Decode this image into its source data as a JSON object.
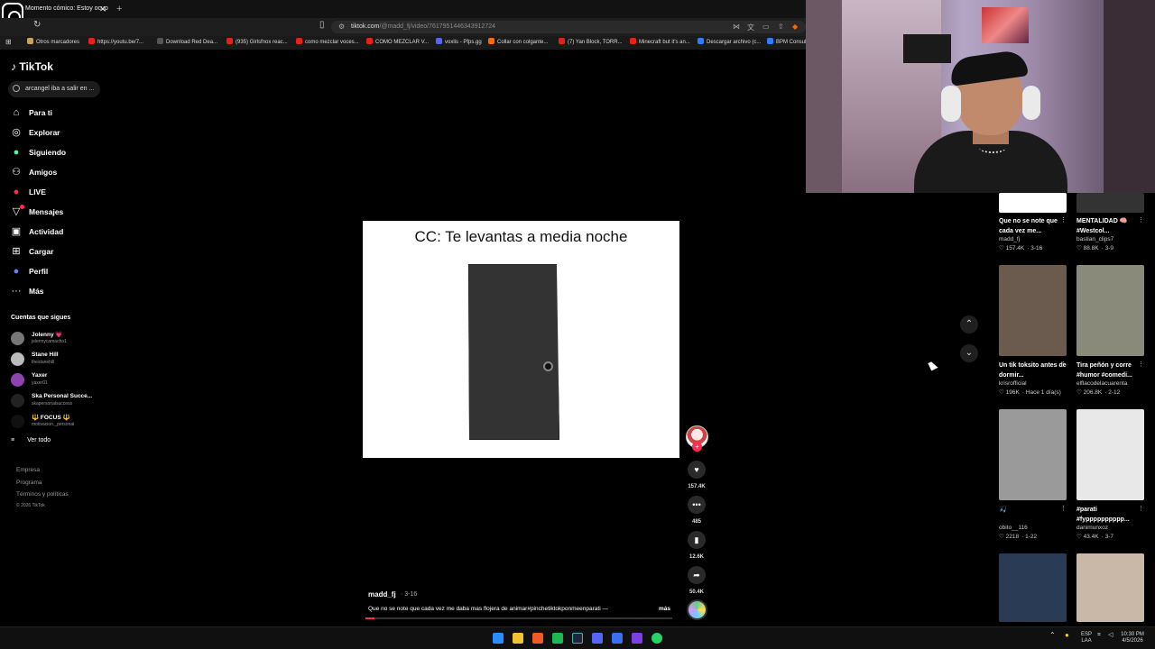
{
  "browser": {
    "tab_title": "Momento cómico: Estoy ocup",
    "tab_close": "✕",
    "new_tab": "+",
    "url_domain": "tiktok.com",
    "url_path": "/@madd_fj/video/7617951446343912724",
    "bookmarks": [
      {
        "label": "Otros marcadores",
        "color": "#c8a45a"
      },
      {
        "label": "https://youtu.be/7...",
        "color": "#e62117"
      },
      {
        "label": "Download Red Dea...",
        "color": "#555"
      },
      {
        "label": "(935) Girlsfnox reac...",
        "color": "#e62117"
      },
      {
        "label": "como mezclar voces...",
        "color": "#e62117"
      },
      {
        "label": "COMO MEZCLAR V...",
        "color": "#e62117"
      },
      {
        "label": "voxlis - Pfps.gg",
        "color": "#5865f2"
      },
      {
        "label": "Collar con colgante...",
        "color": "#ff6a00"
      },
      {
        "label": "(7) Yan Block, TORR...",
        "color": "#e62117"
      },
      {
        "label": "Minecraft but it's an...",
        "color": "#e62117"
      },
      {
        "label": "Descargar archivo (c...",
        "color": "#2d7ff9"
      },
      {
        "label": "BPM Consult",
        "color": "#2d7ff9"
      }
    ]
  },
  "tiktok": {
    "logo": "TikTok",
    "search_value": "arcangel iba a salir en ...",
    "menu": [
      {
        "label": "Para ti",
        "icon": "home-icon",
        "glyph": "⌂"
      },
      {
        "label": "Explorar",
        "icon": "compass-icon",
        "glyph": "◎"
      },
      {
        "label": "Siguiendo",
        "icon": "following-icon",
        "glyph": "●"
      },
      {
        "label": "Amigos",
        "icon": "friends-icon",
        "glyph": "⚇"
      },
      {
        "label": "LIVE",
        "icon": "live-icon",
        "glyph": "●"
      },
      {
        "label": "Mensajes",
        "icon": "messages-icon",
        "glyph": "▽"
      },
      {
        "label": "Actividad",
        "icon": "activity-icon",
        "glyph": "▣"
      },
      {
        "label": "Cargar",
        "icon": "upload-icon",
        "glyph": "⊞"
      },
      {
        "label": "Perfil",
        "icon": "profile-icon",
        "glyph": "●"
      },
      {
        "label": "Más",
        "icon": "more-icon",
        "glyph": "···"
      }
    ],
    "following_header": "Cuentas que sigues",
    "accounts": [
      {
        "name": "Jolenny 💗",
        "handle": "jelennycamacho1",
        "color": "#777"
      },
      {
        "name": "Stane Hill",
        "handle": "thestanehill",
        "color": "#bbb"
      },
      {
        "name": "Yaxer",
        "handle": "yaxer01",
        "color": "#8e44ad"
      },
      {
        "name": "Ska Personal Succe...",
        "handle": "skapersonalsuccess",
        "color": "#222"
      },
      {
        "name": "🔱 FOCUS 🔱",
        "handle": "motivacion._personal",
        "color": "#111"
      }
    ],
    "see_all": "Ver todo",
    "footer": [
      "Empresa",
      "Programa",
      "Términos y políticas",
      "© 2026 TikTok"
    ]
  },
  "video": {
    "overlay_text": "CC: Te levantas a media noche",
    "author": "madd_fj",
    "date": "· 3-16",
    "caption": "Que no se note que cada vez me daba mas flojera de animar#pinchetiktokponmeenparati —",
    "more": "más",
    "progress": 0.03,
    "likes": "157.4K",
    "comments": "485",
    "saves": "12.6K",
    "shares": "50.4K"
  },
  "suggested": [
    {
      "title": "Que no se note que cada vez me...",
      "user": "madd_fj",
      "likes": "♡ 157.4K",
      "date": "· 3-16",
      "thumb": "#ffffff"
    },
    {
      "title": "MENTALIDAD 🧠 #Westcol...",
      "user": "bastian_clips7",
      "likes": "♡ 88.8K",
      "date": "· 3-9",
      "thumb": "#333333"
    },
    {
      "title": "Un tik toksito antes de dormir...",
      "user": "krisrofficial",
      "likes": "♡ 196K",
      "date": "· Hace 1 día(s)",
      "thumb": "#6b5a4e"
    },
    {
      "title": "Tira peñón y corre #humor #comedi...",
      "user": "elflacodelacuarenta",
      "likes": "♡ 206.8K",
      "date": "· 2-12",
      "thumb": "#8a8a7a"
    },
    {
      "title": "🎣",
      "user": "obito__116",
      "likes": "♡ 2218",
      "date": "· 1-22",
      "thumb": "#9a9a9a"
    },
    {
      "title": "#parati #fypppppppppp...",
      "user": "danimunxoz",
      "likes": "♡ 43.4K",
      "date": "· 3-7",
      "thumb": "#e8e8e8"
    },
    {
      "title": "",
      "user": "",
      "likes": "",
      "date": "",
      "thumb": "#2a3b55"
    },
    {
      "title": "",
      "user": "",
      "likes": "",
      "date": "",
      "thumb": "#c9b8a8"
    }
  ],
  "taskbar": {
    "lang": "ESP\nLAA",
    "time": "10:30 PM",
    "date": "4/5/2026"
  }
}
